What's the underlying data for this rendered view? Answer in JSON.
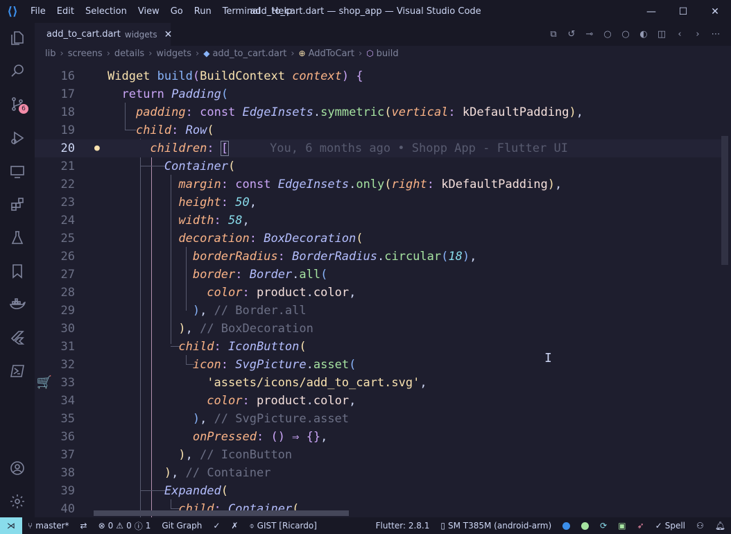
{
  "titlebar": {
    "menu": [
      "File",
      "Edit",
      "Selection",
      "View",
      "Go",
      "Run",
      "Terminal",
      "Help"
    ],
    "title": "add_to_cart.dart — shop_app — Visual Studio Code",
    "minimize": "—",
    "maximize": "☐",
    "close": "✕"
  },
  "activity_bar": {
    "icons": [
      "explorer-icon",
      "search-icon",
      "source-control-icon",
      "run-debug-icon",
      "remote-explorer-icon",
      "extensions-icon",
      "testing-icon",
      "bookmarks-icon",
      "docker-icon",
      "flutter-icon",
      "powershell-icon",
      "account-icon",
      "settings-icon"
    ],
    "source_control_badge": "6"
  },
  "tab": {
    "name": "add_to_cart.dart",
    "dir": "widgets",
    "close": "✕"
  },
  "breadcrumbs": [
    "lib",
    "screens",
    "details",
    "widgets",
    "add_to_cart.dart",
    "AddToCart",
    "build"
  ],
  "editor": {
    "current_line": 20,
    "blame": "You, 6 months ago • Shopp App - Flutter UI",
    "line_numbers": [
      "16",
      "17",
      "18",
      "19",
      "20",
      "21",
      "22",
      "23",
      "24",
      "25",
      "26",
      "27",
      "28",
      "29",
      "30",
      "31",
      "32",
      "33",
      "34",
      "35",
      "36",
      "37",
      "38",
      "39",
      "40"
    ],
    "lines": {
      "l16": [
        "Widget",
        "build",
        "BuildContext",
        "context"
      ],
      "l17": [
        "return",
        "Padding"
      ],
      "l18": [
        "padding",
        "const",
        "EdgeInsets",
        "symmetric",
        "vertical",
        "kDefaultPadding"
      ],
      "l19": [
        "child",
        "Row"
      ],
      "l20": [
        "children"
      ],
      "l21": [
        "Container"
      ],
      "l22": [
        "margin",
        "const",
        "EdgeInsets",
        "only",
        "right",
        "kDefaultPadding"
      ],
      "l23": [
        "height",
        "50"
      ],
      "l24": [
        "width",
        "58"
      ],
      "l25": [
        "decoration",
        "BoxDecoration"
      ],
      "l26": [
        "borderRadius",
        "BorderRadius",
        "circular",
        "18"
      ],
      "l27": [
        "border",
        "Border",
        "all"
      ],
      "l28": [
        "color",
        "product",
        "color"
      ],
      "l29": [
        "// Border.all"
      ],
      "l30": [
        "// BoxDecoration"
      ],
      "l31": [
        "child",
        "IconButton"
      ],
      "l32": [
        "icon",
        "SvgPicture",
        "asset"
      ],
      "l33": [
        "'assets/icons/add_to_cart.svg'"
      ],
      "l34": [
        "color",
        "product",
        "color"
      ],
      "l35": [
        "// SvgPicture.asset"
      ],
      "l36": [
        "onPressed",
        "() ⇒ {}"
      ],
      "l37": [
        "// IconButton"
      ],
      "l38": [
        "// Container"
      ],
      "l39": [
        "Expanded"
      ],
      "l40": [
        "child",
        "Container"
      ]
    }
  },
  "status_bar": {
    "branch": "master*",
    "errors": "0",
    "warnings": "0",
    "info": "1",
    "git_graph": "Git Graph",
    "gist": "GIST [Ricardo]",
    "flutter": "Flutter: 2.8.1",
    "device": "SM T385M (android-arm)",
    "spell": "Spell"
  },
  "colors": {
    "background": "#1e1e2e",
    "keyword": "#cba6f7",
    "class": "#f9e2af",
    "property": "#fab387",
    "number": "#89dceb",
    "comment": "#6c7086"
  }
}
